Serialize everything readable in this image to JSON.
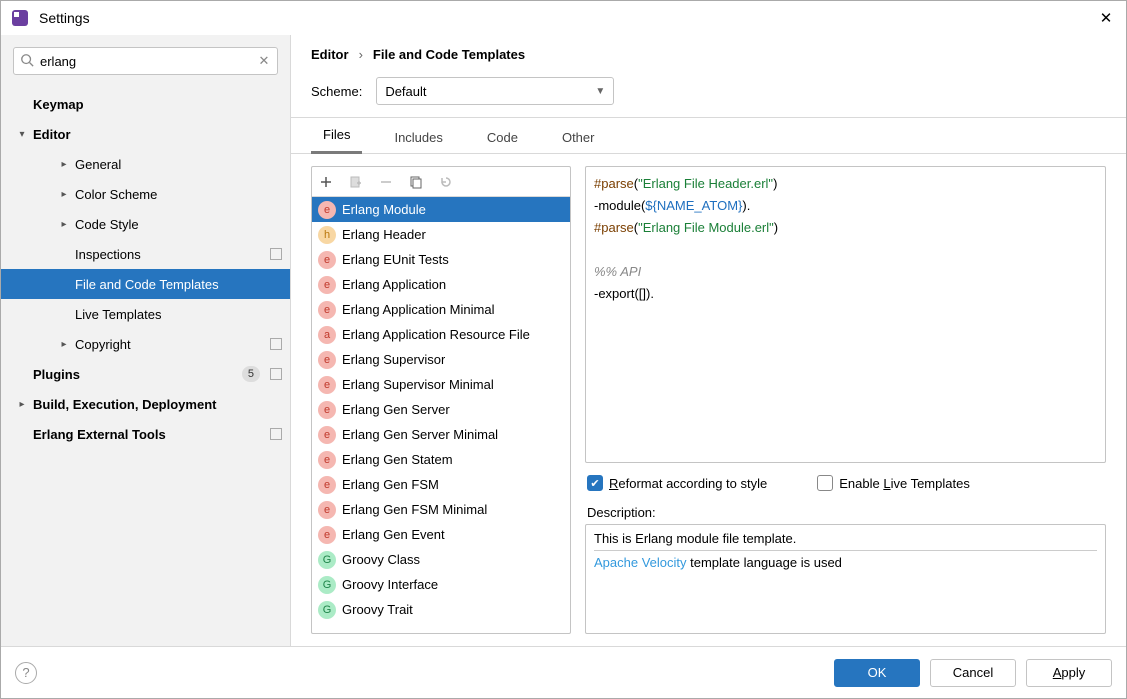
{
  "window_title": "Settings",
  "search": {
    "value": "erlang"
  },
  "sidebar": {
    "items": [
      {
        "label": "Keymap",
        "bold": true,
        "chev": "",
        "level": 0
      },
      {
        "label": "Editor",
        "bold": true,
        "chev": "down",
        "level": 0
      },
      {
        "label": "General",
        "chev": "right",
        "level": 1
      },
      {
        "label": "Color Scheme",
        "chev": "right",
        "level": 1
      },
      {
        "label": "Code Style",
        "chev": "right",
        "level": 1
      },
      {
        "label": "Inspections",
        "chev": "",
        "level": 1,
        "icon": true
      },
      {
        "label": "File and Code Templates",
        "chev": "",
        "level": 1,
        "selected": true
      },
      {
        "label": "Live Templates",
        "chev": "",
        "level": 1
      },
      {
        "label": "Copyright",
        "chev": "right",
        "level": 1,
        "icon": true
      },
      {
        "label": "Plugins",
        "bold": true,
        "chev": "",
        "level": 0,
        "badge": "5",
        "icon": true
      },
      {
        "label": "Build, Execution, Deployment",
        "bold": true,
        "chev": "right",
        "level": 0
      },
      {
        "label": "Erlang External Tools",
        "bold": true,
        "chev": "",
        "level": 0,
        "icon": true
      }
    ]
  },
  "breadcrumb": {
    "a": "Editor",
    "b": "File and Code Templates"
  },
  "scheme": {
    "label": "Scheme:",
    "value": "Default"
  },
  "tabs": [
    "Files",
    "Includes",
    "Code",
    "Other"
  ],
  "active_tab": 0,
  "templates": [
    {
      "icon": "e",
      "name": "Erlang Module",
      "selected": true
    },
    {
      "icon": "h",
      "name": "Erlang Header"
    },
    {
      "icon": "e",
      "name": "Erlang EUnit Tests"
    },
    {
      "icon": "e",
      "name": "Erlang Application"
    },
    {
      "icon": "e",
      "name": "Erlang Application Minimal"
    },
    {
      "icon": "a",
      "name": "Erlang Application Resource File"
    },
    {
      "icon": "e",
      "name": "Erlang Supervisor"
    },
    {
      "icon": "e",
      "name": "Erlang Supervisor Minimal"
    },
    {
      "icon": "e",
      "name": "Erlang Gen Server"
    },
    {
      "icon": "e",
      "name": "Erlang Gen Server Minimal"
    },
    {
      "icon": "e",
      "name": "Erlang Gen Statem"
    },
    {
      "icon": "e",
      "name": "Erlang Gen FSM"
    },
    {
      "icon": "e",
      "name": "Erlang Gen FSM Minimal"
    },
    {
      "icon": "e",
      "name": "Erlang Gen Event"
    },
    {
      "icon": "G",
      "name": "Groovy Class"
    },
    {
      "icon": "G",
      "name": "Groovy Interface"
    },
    {
      "icon": "G",
      "name": "Groovy Trait"
    }
  ],
  "code": {
    "l1a": "#parse",
    "l1b": "(",
    "l1c": "\"Erlang File Header.erl\"",
    "l1d": ")",
    "l2a": "-module(",
    "l2b": "${",
    "l2c": "NAME_ATOM",
    "l2d": "}",
    "l2e": ").",
    "l3a": "#parse",
    "l3b": "(",
    "l3c": "\"Erlang File Module.erl\"",
    "l3d": ")",
    "l4": "%% API",
    "l5": "-export([])."
  },
  "opts": {
    "reformat": "Reformat according to style",
    "livetpl": "Enable Live Templates",
    "reformat_checked": true,
    "livetpl_checked": false
  },
  "desc": {
    "label": "Description:",
    "line1": "This is Erlang module file template.",
    "link": "Apache Velocity",
    "line2": " template language is used"
  },
  "footer": {
    "ok": "OK",
    "cancel": "Cancel",
    "apply": "Apply"
  }
}
